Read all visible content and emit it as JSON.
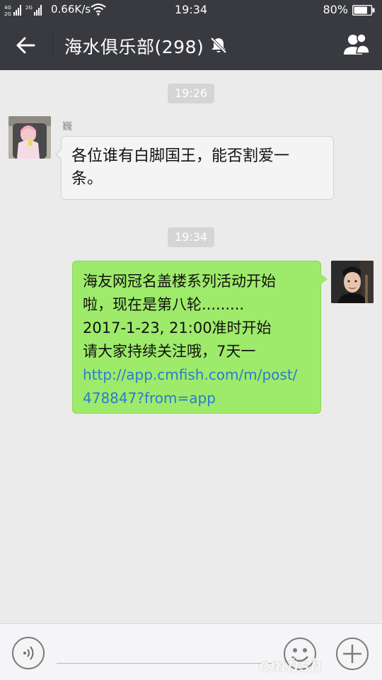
{
  "status_bar": {
    "network_speed": "0.66K/s",
    "time": "19:34",
    "battery_text": "80%",
    "battery_level": 0.8
  },
  "header": {
    "title": "海水俱乐部(298)",
    "back_icon": "arrow-left-icon",
    "mute_icon": "bell-off-icon",
    "members_icon": "group-people-icon"
  },
  "chat": {
    "messages": [
      {
        "timestamp": "19:26",
        "sender": "巍",
        "side": "left",
        "text": "各位谁有白脚国王，能否割爱一条。",
        "lines": [
          "各位谁有白脚国王，能否割爱一",
          "条。"
        ]
      },
      {
        "timestamp": "19:34",
        "side": "right",
        "lines": [
          "海友网冠名盖楼系列活动开始",
          "啦，现在是第八轮.........",
          "2017-1-23, 21:00准时开始",
          "请大家持续关注哦，7天一"
        ],
        "link_lines": [
          "http://app.cmfish.com/m/post/",
          "478847?from=app"
        ]
      }
    ]
  },
  "input_bar": {
    "voice_icon": "voice-icon",
    "emoji_icon": "smiley-icon",
    "plus_icon": "plus-icon"
  },
  "watermark": "cmfish",
  "colors": {
    "header_bg": "#393a3f",
    "chat_bg": "#ebebeb",
    "own_bubble": "#9eea6a",
    "other_bubble": "#f4f4f4",
    "link": "#2a7bd3"
  }
}
